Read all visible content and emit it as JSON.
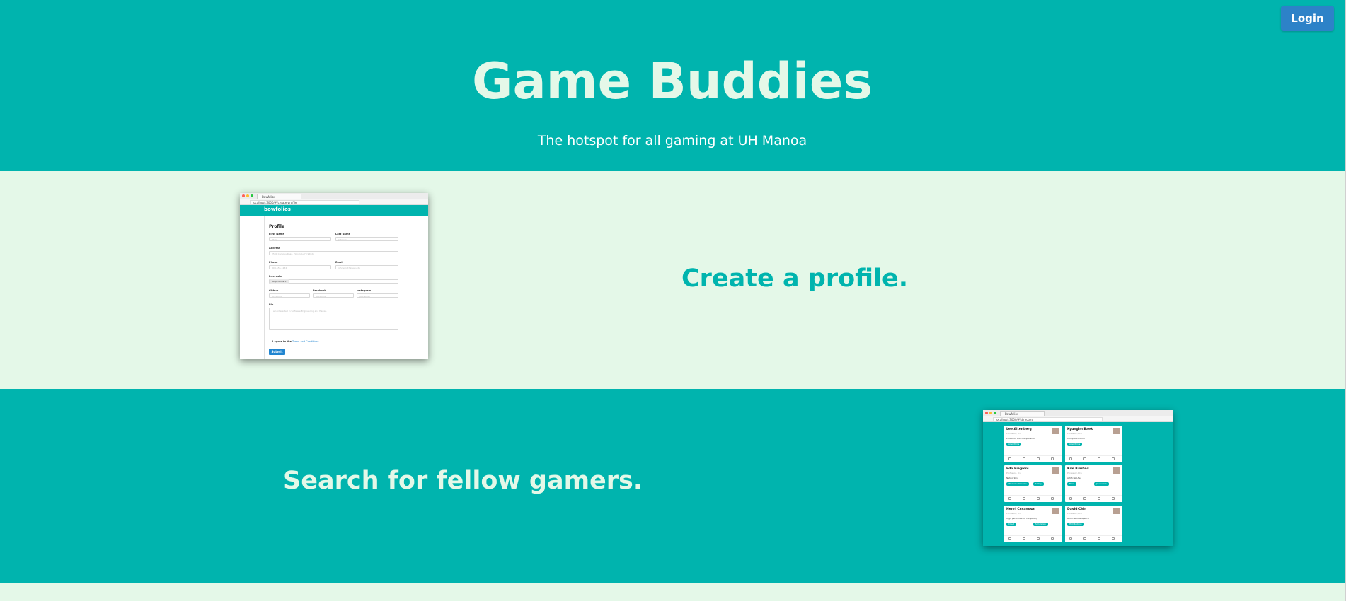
{
  "header": {
    "login_label": "Login",
    "title": "Game Buddies",
    "subtitle": "The hotspot for all gaming at UH Manoa"
  },
  "features": {
    "profile_heading": "Create a profile.",
    "search_heading": "Search for fellow gamers."
  },
  "profile_shot": {
    "tab_title": "Bowfolios",
    "url": "localhost:3000/#/create-profile",
    "brand": "bowfolios",
    "form_title": "Profile",
    "labels": {
      "first_name": "First Name",
      "last_name": "Last Name",
      "address": "Address",
      "phone": "Phone",
      "email": "Email",
      "interests": "Interests",
      "github": "Github",
      "facebook": "Facebook",
      "instagram": "Instagram",
      "bio": "Bio"
    },
    "placeholders": {
      "first_name": "Philip",
      "last_name": "Johnson",
      "address": "2500 Campus Road, Honolulu, HI 96822",
      "phone": "808-555-1234",
      "email": "johnson@hawaii.edu",
      "github": "johnsonhi",
      "facebook": "johnsonfb",
      "instagram": "johnsonig",
      "bio": "I am interested in Software Engineering and Hawaii."
    },
    "interest_chip": "Algorithms ×",
    "terms_prefix": "I agree to the",
    "terms_link": "Terms and Conditions",
    "submit_label": "Submit"
  },
  "search_shot": {
    "tab_title": "Bowfolios",
    "url": "localhost:3000/#/directory",
    "cards": [
      {
        "name": "Lee Altenberg",
        "sub": "Professor, ICS",
        "desc": "Evolution and Computation",
        "tags": [
          "Algorithms"
        ]
      },
      {
        "name": "Kyungim Baek",
        "sub": "Professor, ICS",
        "desc": "Computer Vision",
        "tags": [
          "Algorithms"
        ]
      },
      {
        "name": "Edo Biagioni",
        "sub": "Professor, ICS",
        "desc": "Networking",
        "tags": [
          "Wireless Networks",
          "Safety"
        ]
      },
      {
        "name": "Kim Binsted",
        "sub": "Professor, ICS",
        "desc": "Artificial Life",
        "tags": [
          "Mars",
          "Journalism"
        ]
      },
      {
        "name": "Henri Casanova",
        "sub": "Professor, ICS",
        "desc": "High performance computing",
        "tags": [
          "Cloud",
          "Simulation"
        ]
      },
      {
        "name": "David Chin",
        "sub": "Professor, ICS",
        "desc": "Artificial Intelligence",
        "tags": [
          "HCI/Machine"
        ]
      }
    ]
  },
  "colors": {
    "teal": "#00b4ae",
    "mint": "#e4f8e8",
    "login_blue": "#2d82c8"
  }
}
